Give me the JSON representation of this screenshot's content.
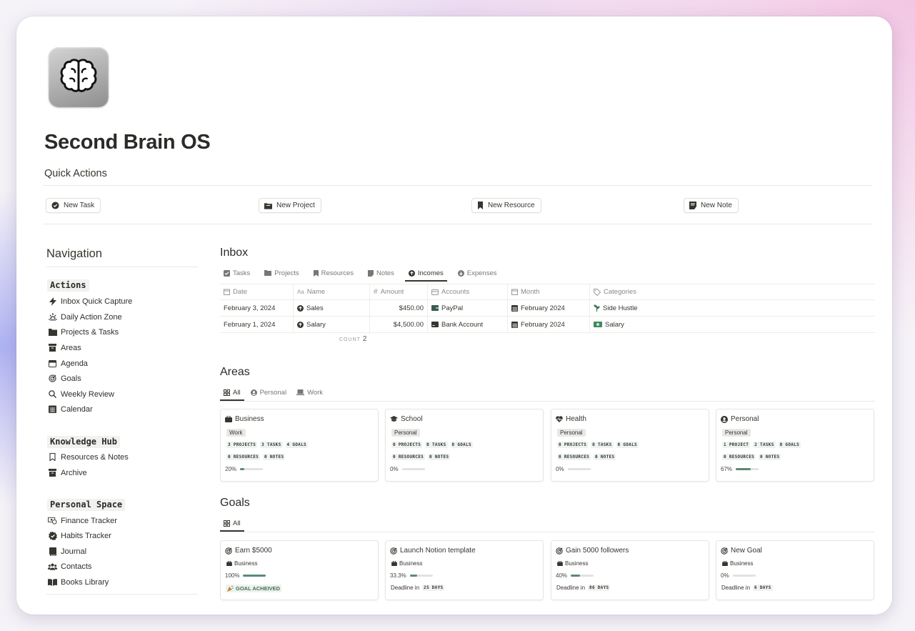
{
  "page": {
    "title": "Second Brain OS",
    "icon": "brain-icon"
  },
  "quick_actions": {
    "heading": "Quick Actions",
    "buttons": [
      {
        "label": "New Task",
        "icon": "check-circle-icon"
      },
      {
        "label": "New Project",
        "icon": "folder-icon"
      },
      {
        "label": "New Resource",
        "icon": "bookmark-icon"
      },
      {
        "label": "New Note",
        "icon": "note-icon"
      }
    ]
  },
  "navigation": {
    "title": "Navigation",
    "actions": {
      "label": "Actions",
      "items": [
        {
          "label": "Inbox Quick Capture",
          "icon": "bolt-icon"
        },
        {
          "label": "Daily Action Zone",
          "icon": "sunrise-icon"
        },
        {
          "label": "Projects & Tasks",
          "icon": "folder-icon"
        },
        {
          "label": "Areas",
          "icon": "archive-icon"
        },
        {
          "label": "Agenda",
          "icon": "calendar-icon"
        },
        {
          "label": "Goals",
          "icon": "target-icon"
        },
        {
          "label": "Weekly Review",
          "icon": "search-icon"
        },
        {
          "label": "Calendar",
          "icon": "calendar-grid-icon"
        }
      ]
    },
    "knowledge": {
      "label": "Knowledge Hub",
      "items": [
        {
          "label": "Resources & Notes",
          "icon": "bookmark-icon"
        },
        {
          "label": "Archive",
          "icon": "archive-icon"
        }
      ]
    },
    "personal": {
      "label": "Personal Space",
      "items": [
        {
          "label": "Finance Tracker",
          "icon": "money-icon"
        },
        {
          "label": "Habits Tracker",
          "icon": "badge-check-icon"
        },
        {
          "label": "Journal",
          "icon": "journal-icon"
        },
        {
          "label": "Contacts",
          "icon": "people-icon"
        },
        {
          "label": "Books Library",
          "icon": "book-icon"
        }
      ]
    }
  },
  "inbox": {
    "title": "Inbox",
    "tabs": [
      "Tasks",
      "Projects",
      "Resources",
      "Notes",
      "Incomes",
      "Expenses"
    ],
    "active_tab": "Incomes",
    "columns": [
      "Date",
      "Name",
      "Amount",
      "Accounts",
      "Month",
      "Categories"
    ],
    "rows": [
      {
        "date": "February 3, 2024",
        "name": "Sales",
        "amount": "$450.00",
        "account": "PayPal",
        "month": "February 2024",
        "category": "Side Hustle"
      },
      {
        "date": "February 1, 2024",
        "name": "Salary",
        "amount": "$4,500.00",
        "account": "Bank Account",
        "month": "February 2024",
        "category": "Salary"
      }
    ],
    "count_label": "COUNT",
    "count": "2"
  },
  "areas": {
    "title": "Areas",
    "tabs": [
      "All",
      "Personal",
      "Work"
    ],
    "cards": [
      {
        "name": "Business",
        "tag": "Work",
        "chips1": [
          "3 PROJECTS",
          "3 TASKS",
          "4 GOALS"
        ],
        "chips2": [
          "0 RESOURCES",
          "0 NOTES"
        ],
        "progress": "20%",
        "progress_value": 0.2
      },
      {
        "name": "School",
        "tag": "Personal",
        "chips1": [
          "0 PROJECTS",
          "0 TASKS",
          "0 GOALS"
        ],
        "chips2": [
          "0 RESOURCES",
          "0 NOTES"
        ],
        "progress": "0%",
        "progress_value": 0
      },
      {
        "name": "Health",
        "tag": "Personal",
        "chips1": [
          "0 PROJECTS",
          "0 TASKS",
          "0 GOALS"
        ],
        "chips2": [
          "0 RESOURCES",
          "0 NOTES"
        ],
        "progress": "0%",
        "progress_value": 0
      },
      {
        "name": "Personal",
        "tag": "Personal",
        "chips1": [
          "1 PROJECT",
          "2 TASKS",
          "0 GOALS"
        ],
        "chips2": [
          "0 RESOURCES",
          "0 NOTES"
        ],
        "progress": "67%",
        "progress_value": 0.67
      }
    ]
  },
  "goals": {
    "title": "Goals",
    "tabs": [
      "All"
    ],
    "cards": [
      {
        "name": "Earn $5000",
        "area": "Business",
        "progress": "100%",
        "progress_value": 1.0,
        "status": "GOAL ACHEIVED"
      },
      {
        "name": "Launch Notion template",
        "area": "Business",
        "progress": "33.3%",
        "progress_value": 0.333,
        "deadline_label": "Deadline in",
        "deadline": "25 DAYS"
      },
      {
        "name": "Gain 5000 followers",
        "area": "Business",
        "progress": "40%",
        "progress_value": 0.4,
        "deadline_label": "Deadline in",
        "deadline": "86 DAYS"
      },
      {
        "name": "New Goal",
        "area": "Business",
        "progress": "0%",
        "progress_value": 0,
        "deadline_label": "Deadline in",
        "deadline": "6 DAYS"
      }
    ]
  }
}
